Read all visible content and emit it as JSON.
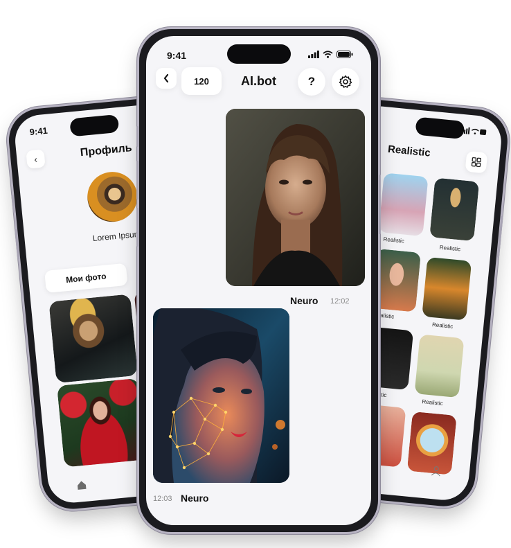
{
  "left_screen": {
    "time": "9:41",
    "back_icon": "chevron-left-icon",
    "title": "Профиль",
    "user_name": "Lorem Ipsum",
    "tab_my_photos": "Мои фото",
    "nav_home_icon": "home-icon"
  },
  "right_screen": {
    "title": "Realistic",
    "grid_icon": "grid-icon",
    "card_labels": [
      "Realistic",
      "Realistic",
      "Realistic",
      "Realistic",
      "Realistic",
      "Realistic"
    ],
    "nav_profile_icon": "user-icon"
  },
  "center_screen": {
    "time": "9:41",
    "status_icons": [
      "signal-icon",
      "wifi-icon",
      "battery-icon"
    ],
    "back_icon": "chevron-left-icon",
    "counter": "120",
    "title": "AI.bot",
    "help_label": "?",
    "settings_icon": "gear-icon",
    "messages": [
      {
        "sender": "Neuro",
        "time": "12:02",
        "align": "right"
      },
      {
        "sender": "Neuro",
        "time": "12:03",
        "align": "left"
      }
    ]
  },
  "colors": {
    "screen_bg": "#f5f5f8",
    "frame": "#1b1b1f",
    "text": "#111111",
    "muted": "#888888"
  }
}
